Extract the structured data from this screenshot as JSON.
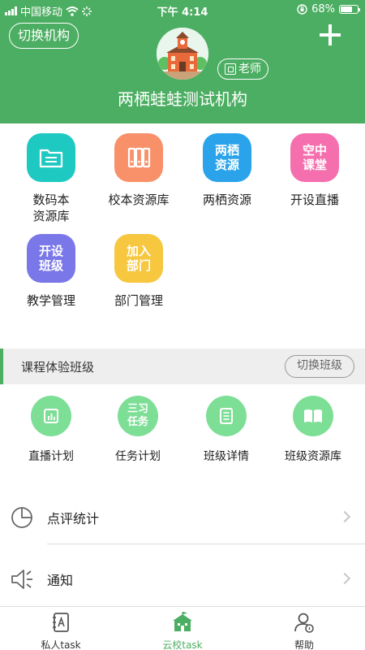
{
  "status_bar": {
    "carrier": "中国移动",
    "time": "下午 4:14",
    "battery_percent": "68%",
    "battery_level": 0.68
  },
  "header": {
    "switch_org_label": "切换机构",
    "role_badge": "老师",
    "org_name": "两栖蛙蛙测试机构"
  },
  "apps": [
    {
      "label": "数码本\n资源库",
      "tile_text": "",
      "icon": "folder-list-icon",
      "color": "#1ec9c2"
    },
    {
      "label": "校本资源库",
      "tile_text": "",
      "icon": "books-icon",
      "color": "#f8916a"
    },
    {
      "label": "两栖资源",
      "tile_text": "两栖\n资源",
      "icon": "",
      "color": "#2aa3ea"
    },
    {
      "label": "开设直播",
      "tile_text": "空中\n课堂",
      "icon": "",
      "color": "#f56fae"
    },
    {
      "label": "教学管理",
      "tile_text": "开设\n班级",
      "icon": "",
      "color": "#7a77e8"
    },
    {
      "label": "部门管理",
      "tile_text": "加入\n部门",
      "icon": "",
      "color": "#f6c73f"
    }
  ],
  "class_section": {
    "title": "课程体验班级",
    "switch_label": "切换班级"
  },
  "class_tools": [
    {
      "label": "直播计划",
      "circle_text": "",
      "icon": "bar-chart-icon"
    },
    {
      "label": "任务计划",
      "circle_text": "三习\n任务",
      "icon": ""
    },
    {
      "label": "班级详情",
      "circle_text": "",
      "icon": "document-icon"
    },
    {
      "label": "班级资源库",
      "circle_text": "",
      "icon": "open-book-icon"
    }
  ],
  "list": [
    {
      "label": "点评统计",
      "icon": "pie-chart-icon"
    },
    {
      "label": "通知",
      "icon": "speaker-icon"
    }
  ],
  "tabs": [
    {
      "label": "私人task",
      "icon": "notebook-icon",
      "active": false
    },
    {
      "label": "云校task",
      "icon": "school-icon",
      "active": true
    },
    {
      "label": "帮助",
      "icon": "help-user-icon",
      "active": false
    }
  ],
  "colors": {
    "primary": "#4cae62",
    "tool_circle": "#7dde96"
  }
}
